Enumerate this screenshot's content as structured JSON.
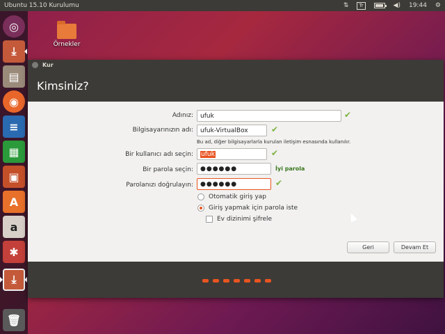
{
  "topbar": {
    "title": "Ubuntu 15.10 Kurulumu",
    "keyboard_layout": "Tr",
    "time": "19:44",
    "icons": [
      "network-arrows-icon",
      "keyboard-icon",
      "battery-icon",
      "volume-icon",
      "gear-icon"
    ]
  },
  "launcher": {
    "items": [
      {
        "name": "ubuntu-dash-icon",
        "color": "#7a2e5a"
      },
      {
        "name": "installer-icon",
        "color": "#c45a3a"
      },
      {
        "name": "files-icon",
        "color": "#9a8a7a"
      },
      {
        "name": "firefox-icon",
        "color": "#e8662a"
      },
      {
        "name": "writer-icon",
        "color": "#2a6ab0"
      },
      {
        "name": "calc-icon",
        "color": "#2a9a3a"
      },
      {
        "name": "impress-icon",
        "color": "#c4502a"
      },
      {
        "name": "software-center-icon",
        "color": "#e8702a"
      },
      {
        "name": "amazon-icon",
        "color": "#d8d0c8"
      },
      {
        "name": "settings-icon",
        "color": "#c4403a"
      },
      {
        "name": "installer-active-icon",
        "color": "#c45a3a"
      },
      {
        "name": "trash-icon",
        "color": "#5a5a5a"
      }
    ]
  },
  "desktop": {
    "folder_label": "Örnekler"
  },
  "window": {
    "title": "Kur",
    "page_title": "Kimsiniz?",
    "form": {
      "name_label": "Adınız:",
      "name_value": "ufuk",
      "computer_label": "Bilgisayarınızın adı:",
      "computer_value": "ufuk-VirtualBox",
      "computer_hint": "Bu ad, diğer bilgisayarlarla kurulan iletişim esnasında kullanılır.",
      "username_label": "Bir kullanıcı adı seçin:",
      "username_value": "ufuk",
      "password_label": "Bir parola seçin:",
      "password_value": "●●●●●●",
      "password_strength": "İyi parola",
      "confirm_label": "Parolanızı doğrulayın:",
      "confirm_value": "●●●●●●",
      "option_auto_login": "Otomatik giriş yap",
      "option_require_password": "Giriş yapmak için parola iste",
      "option_encrypt_home": "Ev dizinimi şifrele"
    },
    "buttons": {
      "back": "Geri",
      "continue": "Devam Et"
    },
    "progress": {
      "total_steps": 7
    }
  }
}
